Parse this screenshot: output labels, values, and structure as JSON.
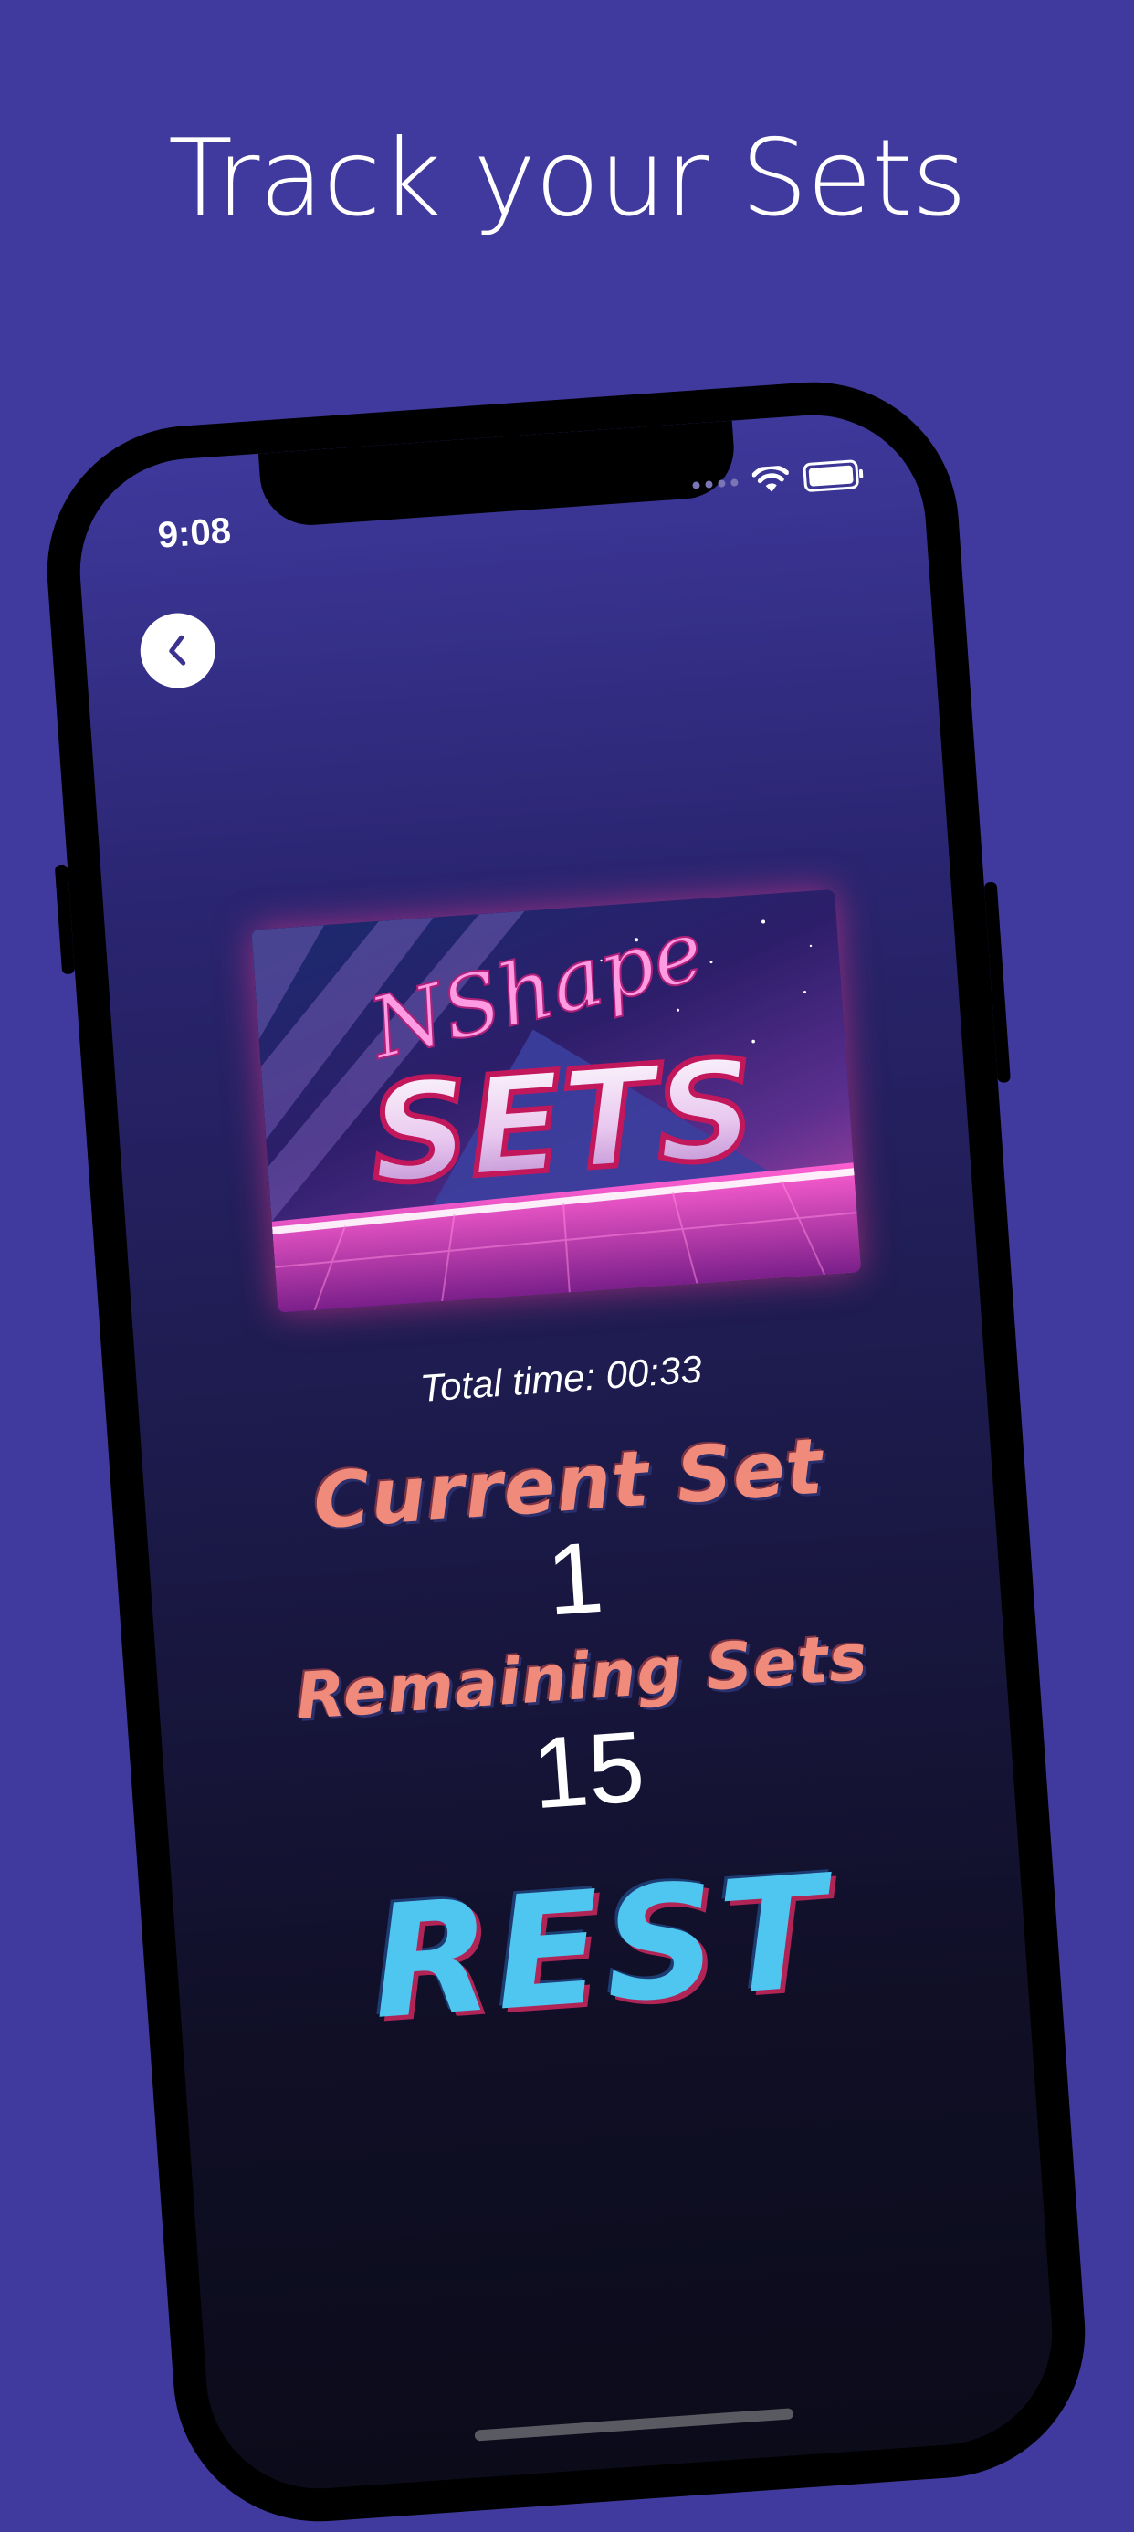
{
  "headline": "Track your Sets",
  "status_bar": {
    "time": "9:08",
    "icons": [
      "signal-dots-icon",
      "wifi-icon",
      "battery-icon"
    ]
  },
  "navigation": {
    "back_icon": "chevron-left-icon"
  },
  "logo": {
    "script_text": "NShape",
    "block_text": "SETS"
  },
  "workout": {
    "total_time": "Total time: 00:33",
    "current_set_label": "Current Set",
    "current_set_value": "1",
    "remaining_sets_label": "Remaining Sets",
    "remaining_sets_value": "15",
    "status": "REST"
  },
  "colors": {
    "background": "#413a9e",
    "label_salmon": "#f08a7a",
    "rest_cyan": "#4fc6f0"
  }
}
